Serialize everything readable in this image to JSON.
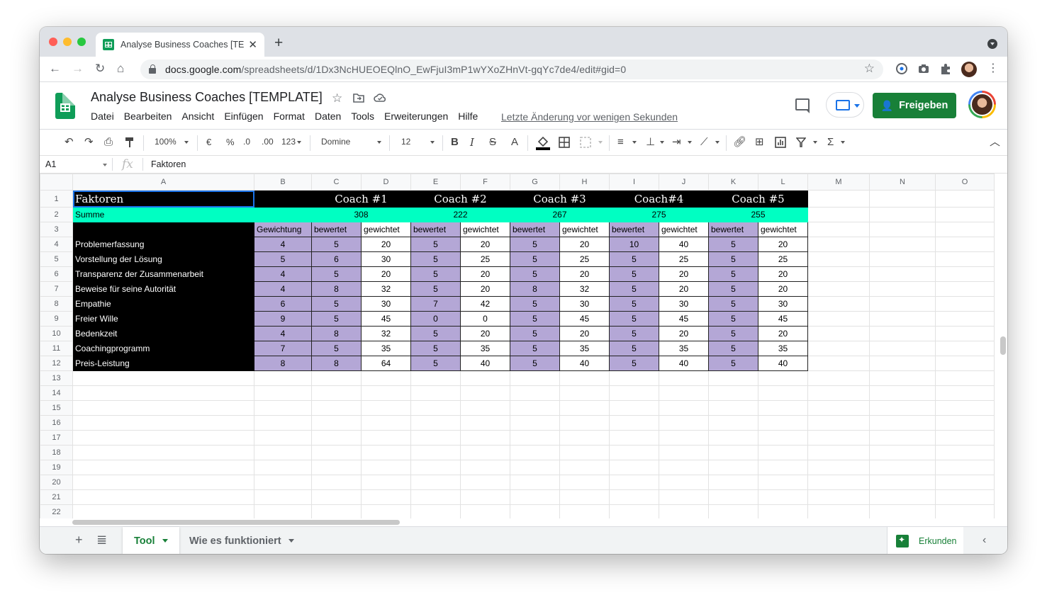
{
  "browser": {
    "tab_title": "Analyse Business Coaches [TEMPLATE]",
    "url_host": "docs.google.com",
    "url_path": "/spreadsheets/d/1Dx3NcHUEOEQlnO_EwFjuI3mP1wYXoZHnVt-gqYc7de4/edit#gid=0"
  },
  "doc": {
    "title": "Analyse Business Coaches [TEMPLATE]",
    "menu": [
      "Datei",
      "Bearbeiten",
      "Ansicht",
      "Einfügen",
      "Format",
      "Daten",
      "Tools",
      "Erweiterungen",
      "Hilfe"
    ],
    "last_edit": "Letzte Änderung vor wenigen Sekunden",
    "share_label": "Freigeben"
  },
  "toolbar": {
    "zoom": "100%",
    "currency": "€",
    "percent": "%",
    "dec_less": ".0",
    "dec_more": ".00",
    "format_more": "123",
    "font": "Domine",
    "font_size": "12"
  },
  "formula": {
    "cell_ref": "A1",
    "fx": "fx",
    "value": "Faktoren"
  },
  "sheet": {
    "columns": [
      "A",
      "B",
      "C",
      "D",
      "E",
      "F",
      "G",
      "H",
      "I",
      "J",
      "K",
      "L",
      "M",
      "N",
      "O"
    ],
    "title_row": {
      "label": "Faktoren",
      "coaches": [
        "Coach #1",
        "Coach #2",
        "Coach #3",
        "Coach#4",
        "Coach #5"
      ]
    },
    "sum_row": {
      "label": "Summe",
      "totals": [
        "308",
        "222",
        "267",
        "275",
        "255"
      ]
    },
    "header_row": {
      "weight": "Gewichtung",
      "rated": "bewertet",
      "weighted": "gewichtet"
    },
    "factors": [
      {
        "name": "Problemerfassung",
        "w": "4",
        "vals": [
          "5",
          "20",
          "5",
          "20",
          "5",
          "20",
          "10",
          "40",
          "5",
          "20"
        ]
      },
      {
        "name": "Vorstellung der Lösung",
        "w": "5",
        "vals": [
          "6",
          "30",
          "5",
          "25",
          "5",
          "25",
          "5",
          "25",
          "5",
          "25"
        ]
      },
      {
        "name": "Transparenz der Zusammenarbeit",
        "w": "4",
        "vals": [
          "5",
          "20",
          "5",
          "20",
          "5",
          "20",
          "5",
          "20",
          "5",
          "20"
        ]
      },
      {
        "name": "Beweise für seine Autorität",
        "w": "4",
        "vals": [
          "8",
          "32",
          "5",
          "20",
          "8",
          "32",
          "5",
          "20",
          "5",
          "20"
        ]
      },
      {
        "name": "Empathie",
        "w": "6",
        "vals": [
          "5",
          "30",
          "7",
          "42",
          "5",
          "30",
          "5",
          "30",
          "5",
          "30"
        ]
      },
      {
        "name": "Freier Wille",
        "w": "9",
        "vals": [
          "5",
          "45",
          "0",
          "0",
          "5",
          "45",
          "5",
          "45",
          "5",
          "45"
        ]
      },
      {
        "name": "Bedenkzeit",
        "w": "4",
        "vals": [
          "8",
          "32",
          "5",
          "20",
          "5",
          "20",
          "5",
          "20",
          "5",
          "20"
        ]
      },
      {
        "name": "Coachingprogramm",
        "w": "7",
        "vals": [
          "5",
          "35",
          "5",
          "35",
          "5",
          "35",
          "5",
          "35",
          "5",
          "35"
        ]
      },
      {
        "name": "Preis-Leistung",
        "w": "8",
        "vals": [
          "8",
          "64",
          "5",
          "40",
          "5",
          "40",
          "5",
          "40",
          "5",
          "40"
        ]
      }
    ],
    "row_numbers": [
      "1",
      "2",
      "3",
      "4",
      "5",
      "6",
      "7",
      "8",
      "9",
      "10",
      "11",
      "12",
      "13",
      "14",
      "15",
      "16",
      "17",
      "18",
      "19",
      "20",
      "21",
      "22"
    ]
  },
  "tabs": {
    "sheets": [
      "Tool",
      "Wie es funktioniert"
    ],
    "explore": "Erkunden"
  },
  "colors": {
    "header_black": "#000000",
    "sum_teal": "#00ffc2",
    "rated_purple": "#b4a7d6",
    "brand_green": "#188038"
  }
}
